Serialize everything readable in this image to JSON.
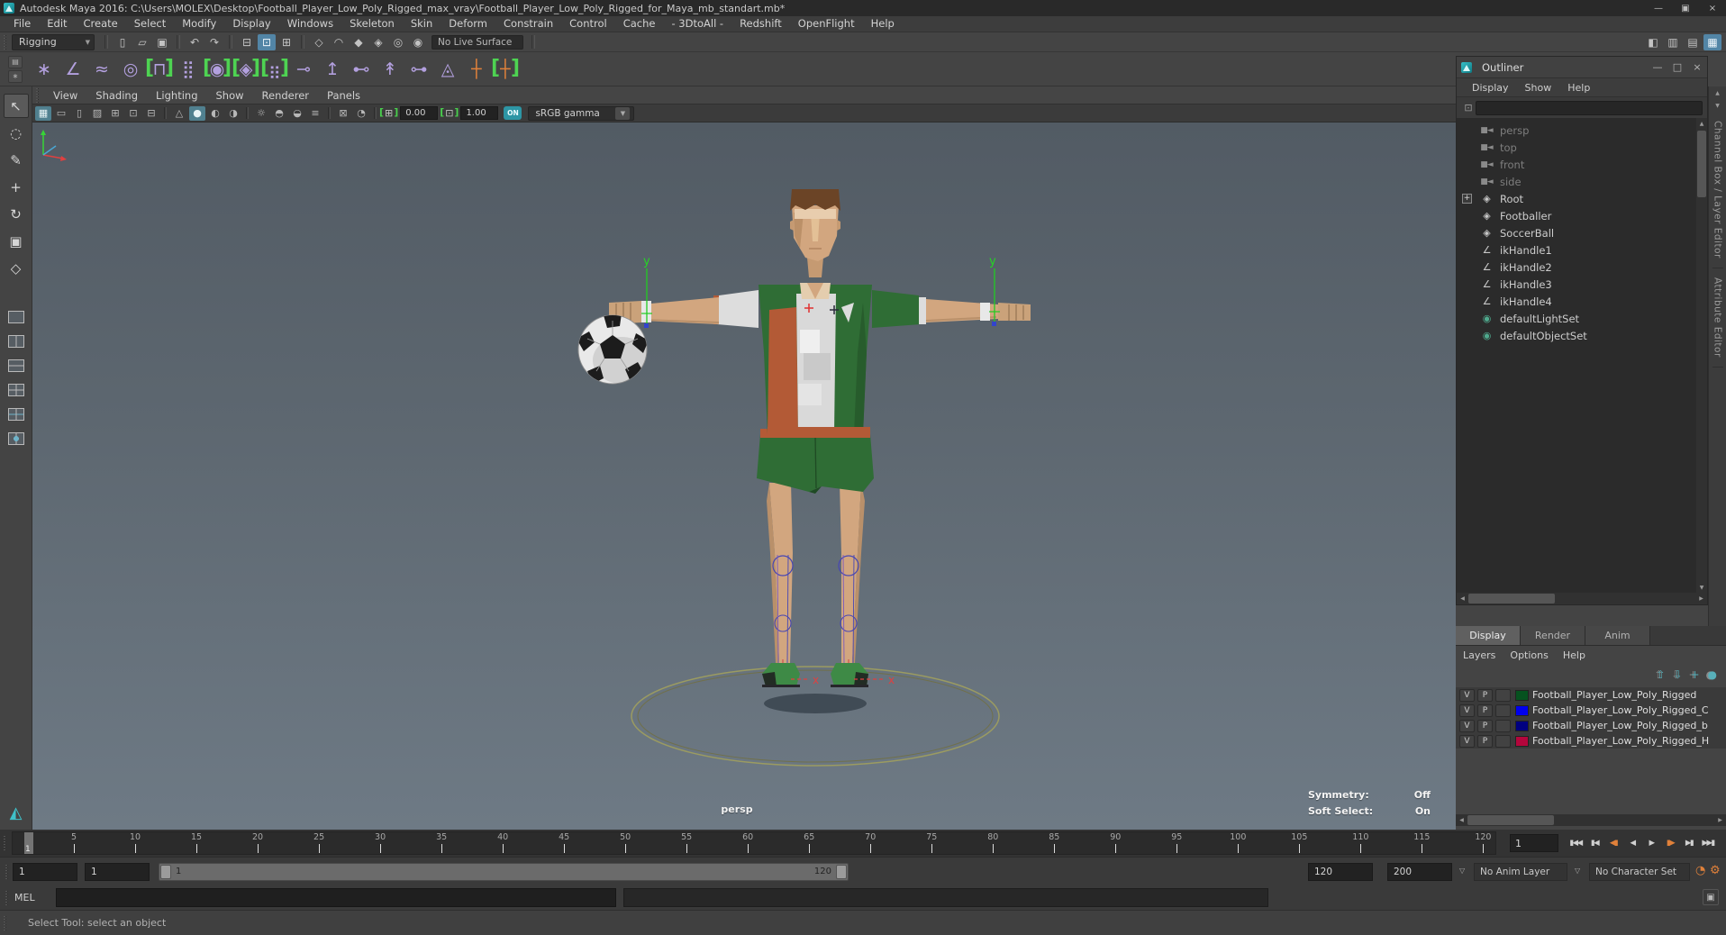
{
  "titlebar": {
    "title": "Autodesk Maya 2016: C:\\Users\\MOLEX\\Desktop\\Football_Player_Low_Poly_Rigged_max_vray\\Football_Player_Low_Poly_Rigged_for_Maya_mb_standart.mb*",
    "window_controls": [
      {
        "name": "minimize-button",
        "glyph": "—"
      },
      {
        "name": "restore-button",
        "glyph": "▣"
      },
      {
        "name": "close-button",
        "glyph": "×"
      }
    ]
  },
  "menu_bar": [
    "File",
    "Edit",
    "Create",
    "Select",
    "Modify",
    "Display",
    "Windows",
    "Skeleton",
    "Skin",
    "Deform",
    "Constrain",
    "Control",
    "Cache",
    "- 3DtoAll -",
    "Redshift",
    "OpenFlight",
    "Help"
  ],
  "icons": {
    "dropdown_arrow": "▼",
    "small_down_arrow": "▽",
    "up_arrow": "▲",
    "down_arrow": "▼",
    "left_arrow": "◀",
    "right_arrow": "▶",
    "search_glyph": "⊡",
    "cmd_box_glyph": "▣",
    "maya_glyph": "◭",
    "shelf_tab_top": "▤",
    "shelf_tab_bottom": "∗"
  },
  "status_line": {
    "menu_set": "Rigging",
    "live_surface": "No Live Surface",
    "file_icons": [
      {
        "name": "new-scene-icon",
        "glyph": "▯"
      },
      {
        "name": "open-scene-icon",
        "glyph": "▱"
      },
      {
        "name": "save-scene-icon",
        "glyph": "▣"
      }
    ],
    "history_icons": [
      {
        "name": "undo-icon",
        "glyph": "↶"
      },
      {
        "name": "redo-icon",
        "glyph": "↷"
      }
    ],
    "selection_icons": [
      {
        "name": "select-by-hierarchy-icon",
        "glyph": "⊟"
      },
      {
        "name": "select-by-object-icon",
        "glyph": "⊡",
        "active": true
      },
      {
        "name": "select-by-component-icon",
        "glyph": "⊞"
      }
    ],
    "snap_icons": [
      {
        "name": "snap-to-grid-icon",
        "glyph": "◇"
      },
      {
        "name": "snap-to-curve-icon",
        "glyph": "◠"
      },
      {
        "name": "snap-to-point-icon",
        "glyph": "◆"
      },
      {
        "name": "snap-to-projected-center-icon",
        "glyph": "◈"
      },
      {
        "name": "snap-to-view-plane-icon",
        "glyph": "◎"
      },
      {
        "name": "make-live-icon",
        "glyph": "◉"
      }
    ],
    "panel_toggle_icons": [
      {
        "name": "show-modeling-toolkit-icon",
        "glyph": "◧"
      },
      {
        "name": "show-hypershade-icon",
        "glyph": "▥"
      },
      {
        "name": "show-tool-settings-icon",
        "glyph": "▤"
      },
      {
        "name": "show-channel-box-icon",
        "glyph": "▦",
        "active": true
      }
    ]
  },
  "shelf": {
    "icons": [
      {
        "name": "joint-tool-icon",
        "glyph": "∗"
      },
      {
        "name": "ik-handle-tool-icon",
        "glyph": "∠"
      },
      {
        "name": "ik-spline-handle-tool-icon",
        "glyph": "≈"
      },
      {
        "name": "quick-rig-tool-icon",
        "glyph": "◎"
      },
      {
        "name": "humanik-icon",
        "glyph": "⊓",
        "bracket": true
      },
      {
        "name": "skeleton-options-icon",
        "glyph": "⣿"
      },
      {
        "name": "circle-control-icon",
        "glyph": "◉",
        "bracket": true
      },
      {
        "name": "box-control-icon",
        "glyph": "◈",
        "bracket": true
      },
      {
        "name": "cluster-icon",
        "glyph": "⣶",
        "bracket": true
      },
      {
        "name": "parent-constraint-icon",
        "glyph": "⊸"
      },
      {
        "name": "point-constraint-icon",
        "glyph": "↥"
      },
      {
        "name": "orient-constraint-icon",
        "glyph": "⊷"
      },
      {
        "name": "aim-constraint-icon",
        "glyph": "↟"
      },
      {
        "name": "scale-constraint-icon",
        "glyph": "⊶"
      },
      {
        "name": "pole-vector-constraint-icon",
        "glyph": "◬"
      },
      {
        "name": "locator-icon",
        "glyph": "┼",
        "style": "orange"
      },
      {
        "name": "locator-handle-icon",
        "glyph": "┼",
        "style": "orange",
        "bracket": true
      }
    ]
  },
  "toolbox": {
    "tools": [
      {
        "name": "select-tool-icon",
        "glyph": "↖",
        "active": true
      },
      {
        "name": "lasso-tool-icon",
        "glyph": "◌"
      },
      {
        "name": "paint-select-tool-icon",
        "glyph": "✎"
      },
      {
        "name": "move-tool-icon",
        "glyph": "+"
      },
      {
        "name": "rotate-tool-icon",
        "glyph": "↻"
      },
      {
        "name": "scale-tool-icon",
        "glyph": "▣"
      },
      {
        "name": "last-tool-icon",
        "glyph": "◇"
      }
    ],
    "layouts": [
      {
        "name": "layout-single-pane-button",
        "style": "l1"
      },
      {
        "name": "layout-two-panes-side-button",
        "style": "l2"
      },
      {
        "name": "layout-two-panes-stacked-button",
        "style": "l3"
      },
      {
        "name": "layout-four-panes-button",
        "style": "l4"
      },
      {
        "name": "layout-three-panes-button",
        "style": "l5"
      },
      {
        "name": "layout-outliner-persp-button",
        "style": "l6"
      }
    ]
  },
  "panel_menus": [
    "View",
    "Shading",
    "Lighting",
    "Show",
    "Renderer",
    "Panels"
  ],
  "viewport_toolbar": {
    "icons": [
      {
        "name": "grid-toggle-icon",
        "glyph": "▦",
        "active": true
      },
      {
        "name": "film-gate-icon",
        "glyph": "▭"
      },
      {
        "name": "resolution-gate-icon",
        "glyph": "▯"
      },
      {
        "name": "gate-mask-icon",
        "glyph": "▨"
      },
      {
        "name": "field-chart-icon",
        "glyph": "⊞"
      },
      {
        "name": "safe-action-icon",
        "glyph": "⊡"
      },
      {
        "name": "safe-title-icon",
        "glyph": "⊟"
      },
      {
        "sep": true
      },
      {
        "name": "wireframe-mode-icon",
        "glyph": "△"
      },
      {
        "name": "shaded-mode-icon",
        "glyph": "●",
        "active": true
      },
      {
        "name": "textured-mode-icon",
        "glyph": "◐"
      },
      {
        "name": "use-default-material-icon",
        "glyph": "◑"
      },
      {
        "sep": true
      },
      {
        "name": "lighting-icon",
        "glyph": "☼"
      },
      {
        "name": "shadows-icon",
        "glyph": "◓"
      },
      {
        "name": "screen-space-ao-icon",
        "glyph": "◒"
      },
      {
        "name": "motion-blur-icon",
        "glyph": "≡"
      },
      {
        "sep": true
      },
      {
        "name": "isolate-select-icon",
        "glyph": "⊠"
      },
      {
        "name": "xray-icon",
        "glyph": "◔"
      },
      {
        "sep": true
      }
    ],
    "exposure": "0.00",
    "gamma": "1.00",
    "exposure_icon_glyph": "⊞",
    "gamma_icon_glyph": "⊡",
    "on_label": "ON",
    "color_transform": "sRGB gamma"
  },
  "viewport_hud": {
    "camera": "persp",
    "symmetry_label": "Symmetry:",
    "symmetry_value": "Off",
    "soft_select_label": "Soft Select:",
    "soft_select_value": "On"
  },
  "scene": {
    "ik_label_left": "y",
    "ik_label_right": "y",
    "foot_label_left": "x",
    "foot_label_right": "x"
  },
  "outliner": {
    "title": "Outliner",
    "window_buttons": [
      {
        "name": "outliner-minimize-button",
        "glyph": "—"
      },
      {
        "name": "outliner-maximize-button",
        "glyph": "□"
      },
      {
        "name": "outliner-close-button",
        "glyph": "×"
      }
    ],
    "menus": [
      "Display",
      "Show",
      "Help"
    ],
    "search_value": "",
    "items": [
      {
        "label": "persp",
        "glyph": "■◄",
        "icon": "camera-icon",
        "icon_class": "cam",
        "muted": true
      },
      {
        "label": "top",
        "glyph": "■◄",
        "icon": "camera-icon",
        "icon_class": "cam",
        "muted": true
      },
      {
        "label": "front",
        "glyph": "■◄",
        "icon": "camera-icon",
        "icon_class": "cam",
        "muted": true
      },
      {
        "label": "side",
        "glyph": "■◄",
        "icon": "camera-icon",
        "icon_class": "cam",
        "muted": true
      },
      {
        "label": "Root",
        "glyph": "◈",
        "icon": "transform-node-icon",
        "icon_class": "tr",
        "expand": true
      },
      {
        "label": "Footballer",
        "glyph": "◈",
        "icon": "transform-node-icon",
        "icon_class": "tr"
      },
      {
        "label": "SoccerBall",
        "glyph": "◈",
        "icon": "transform-node-icon",
        "icon_class": "tr"
      },
      {
        "label": "ikHandle1",
        "glyph": "∠",
        "icon": "ik-handle-icon",
        "icon_class": "ik"
      },
      {
        "label": "ikHandle2",
        "glyph": "∠",
        "icon": "ik-handle-icon",
        "icon_class": "ik"
      },
      {
        "label": "ikHandle3",
        "glyph": "∠",
        "icon": "ik-handle-icon",
        "icon_class": "ik"
      },
      {
        "label": "ikHandle4",
        "glyph": "∠",
        "icon": "ik-handle-icon",
        "icon_class": "ik"
      },
      {
        "label": "defaultLightSet",
        "glyph": "◉",
        "icon": "light-set-icon",
        "icon_class": "set"
      },
      {
        "label": "defaultObjectSet",
        "glyph": "◉",
        "icon": "object-set-icon",
        "icon_class": "set"
      }
    ]
  },
  "right_strip": {
    "tabs": [
      {
        "name": "channel-box-layer-editor-tab",
        "label": "Channel Box / Layer Editor"
      },
      {
        "name": "attribute-editor-tab",
        "label": "Attribute Editor"
      }
    ]
  },
  "layer_editor": {
    "tabs": [
      {
        "label": "Display",
        "active": true
      },
      {
        "label": "Render"
      },
      {
        "label": "Anim"
      }
    ],
    "menus": [
      "Layers",
      "Options",
      "Help"
    ],
    "toolbar_icons": [
      {
        "name": "move-layer-up-icon",
        "glyph": "⇧"
      },
      {
        "name": "move-layer-down-icon",
        "glyph": "⇩"
      },
      {
        "name": "create-empty-layer-icon",
        "glyph": "+"
      },
      {
        "name": "create-layer-from-selected-icon",
        "glyph": "●"
      }
    ],
    "layers": [
      {
        "visible": "V",
        "playback": "P",
        "color": "#06521f",
        "name": "Football_Player_Low_Poly_Rigged"
      },
      {
        "visible": "V",
        "playback": "P",
        "color": "#0000ee",
        "name": "Football_Player_Low_Poly_Rigged_C"
      },
      {
        "visible": "V",
        "playback": "P",
        "color": "#000080",
        "name": "Football_Player_Low_Poly_Rigged_b"
      },
      {
        "visible": "V",
        "playback": "P",
        "color": "#b4063c",
        "name": "Football_Player_Low_Poly_Rigged_H"
      }
    ]
  },
  "time_slider": {
    "ticks": [
      5,
      10,
      15,
      20,
      25,
      30,
      35,
      40,
      45,
      50,
      55,
      60,
      65,
      70,
      75,
      80,
      85,
      90,
      95,
      100,
      105,
      110,
      115,
      120
    ],
    "current_frame": "1",
    "frame_field": "1",
    "playback": [
      {
        "name": "go-to-start-button",
        "glyph": "▮◀◀"
      },
      {
        "name": "step-back-key-button",
        "glyph": "▮◀"
      },
      {
        "name": "step-back-frame-button",
        "glyph": "◀▮",
        "key": true
      },
      {
        "name": "play-backwards-button",
        "glyph": "◀"
      },
      {
        "name": "play-forwards-button",
        "glyph": "▶"
      },
      {
        "name": "step-forward-frame-button",
        "glyph": "▮▶",
        "key": true
      },
      {
        "name": "step-forward-key-button",
        "glyph": "▶▮"
      },
      {
        "name": "go-to-end-button",
        "glyph": "▶▶▮"
      }
    ]
  },
  "range_slider": {
    "anim_start": "1",
    "playback_start": "1",
    "slider_min_label": "1",
    "slider_max_label": "120",
    "playback_end": "120",
    "anim_end": "200",
    "anim_layer": "No Anim Layer",
    "character_set": "No Character Set",
    "auto_key_glyph": "◔",
    "prefs_glyph": "⚙"
  },
  "command_line": {
    "label": "MEL"
  },
  "help_line": {
    "text": "Select Tool: select an object"
  }
}
